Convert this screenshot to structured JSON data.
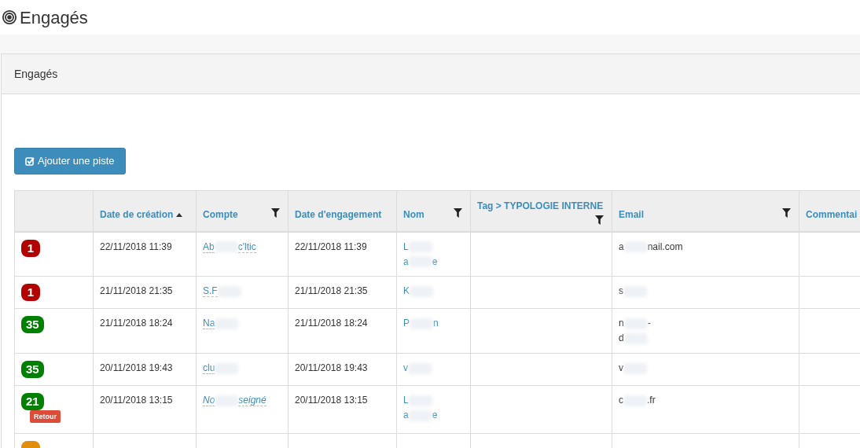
{
  "page_title": "Engagés",
  "panel": {
    "title": "Engagés"
  },
  "add_button": {
    "label": "Ajouter une piste"
  },
  "table": {
    "columns": [
      {
        "sorted": false,
        "filter": false
      },
      {
        "label": "Date de création",
        "sorted": true,
        "filter": false
      },
      {
        "label": "Compte",
        "sorted": false,
        "filter": true
      },
      {
        "label": "Date d'engagement",
        "sorted": false,
        "filter": false
      },
      {
        "label": "Nom",
        "sorted": false,
        "filter": true
      },
      {
        "label": "Tag > TYPOLOGIE INTERNE",
        "sorted": false,
        "filter": true
      },
      {
        "label": "Email",
        "sorted": false,
        "filter": true
      },
      {
        "label": "Commentai",
        "sorted": false,
        "filter": false
      }
    ],
    "rows": [
      {
        "badge": {
          "value": "1",
          "color": "#b30000"
        },
        "created": "22/11/2018 11:39",
        "compte": {
          "lines": [
            [
              "Ab",
              "c'ltic"
            ]
          ],
          "italic": false,
          "redacted": true
        },
        "engaged": "22/11/2018 11:39",
        "nom": {
          "lines": [
            [
              "L"
            ],
            [
              "a",
              "e"
            ]
          ],
          "redacted": true
        },
        "email": {
          "lines": [
            [
              "a",
              "nail.com"
            ]
          ],
          "redacted": true
        }
      },
      {
        "badge": {
          "value": "1",
          "color": "#b30000"
        },
        "created": "21/11/2018 21:35",
        "compte": {
          "lines": [
            [
              "S.F"
            ]
          ],
          "italic": false,
          "redacted": true
        },
        "engaged": "21/11/2018 21:35",
        "nom": {
          "lines": [
            [
              "K"
            ]
          ],
          "redacted": true
        },
        "email": {
          "lines": [
            [
              "s"
            ]
          ],
          "redacted": true
        }
      },
      {
        "badge": {
          "value": "35",
          "color": "#008000"
        },
        "created": "21/11/2018 18:24",
        "compte": {
          "lines": [
            [
              "Na"
            ]
          ],
          "italic": false,
          "redacted": true
        },
        "engaged": "21/11/2018 18:24",
        "nom": {
          "lines": [
            [
              "P",
              "n"
            ]
          ],
          "redacted": true
        },
        "email": {
          "lines": [
            [
              "n",
              "-"
            ],
            [
              "d"
            ]
          ],
          "redacted": true
        }
      },
      {
        "badge": {
          "value": "35",
          "color": "#008000"
        },
        "created": "20/11/2018 19:43",
        "compte": {
          "lines": [
            [
              "clu"
            ]
          ],
          "italic": false,
          "redacted": true
        },
        "engaged": "20/11/2018 19:43",
        "nom": {
          "lines": [
            [
              "v"
            ]
          ],
          "redacted": true
        },
        "email": {
          "lines": [
            [
              "v"
            ]
          ],
          "redacted": true
        }
      },
      {
        "badge": {
          "value": "21",
          "color": "#008000"
        },
        "label": "Retour",
        "created": "20/11/2018 13:15",
        "compte": {
          "lines": [
            [
              "No",
              "seigné"
            ]
          ],
          "italic": true,
          "redacted": true
        },
        "engaged": "20/11/2018 13:15",
        "nom": {
          "lines": [
            [
              "L"
            ],
            [
              "a",
              "e"
            ]
          ],
          "redacted": true
        },
        "email": {
          "lines": [
            [
              "c",
              ".fr"
            ]
          ],
          "redacted": true
        }
      },
      {
        "badge": {
          "color": "#e08e0b"
        }
      }
    ]
  }
}
